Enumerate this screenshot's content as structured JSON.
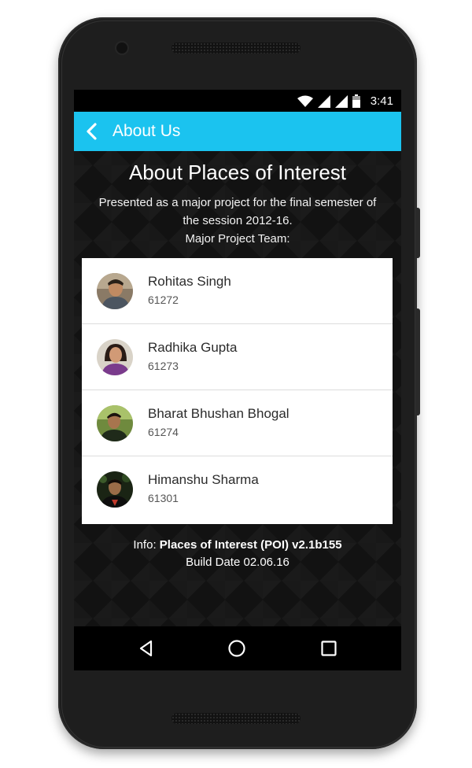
{
  "status_bar": {
    "time": "3:41",
    "icons": [
      "wifi-icon",
      "signal-icon",
      "signal-icon",
      "battery-icon"
    ]
  },
  "app_bar": {
    "title": "About Us",
    "back_icon": "chevron-left-icon",
    "color": "#1bc3ef"
  },
  "about": {
    "heading": "About Places of Interest",
    "line1": "Presented as a major project for the final semester of",
    "line2": "the session 2012-16.",
    "line3": "Major Project Team:"
  },
  "team": [
    {
      "name": "Rohitas Singh",
      "roll": "61272"
    },
    {
      "name": "Radhika Gupta",
      "roll": "61273"
    },
    {
      "name": "Bharat Bhushan Bhogal",
      "roll": "61274"
    },
    {
      "name": "Himanshu Sharma",
      "roll": "61301"
    }
  ],
  "info": {
    "prefix": "Info: ",
    "app_version": "Places of Interest (POI) v2.1b155",
    "build_date": "Build Date 02.06.16"
  },
  "nav_bar": {
    "back": "triangle-back-icon",
    "home": "circle-home-icon",
    "recents": "square-recents-icon"
  }
}
